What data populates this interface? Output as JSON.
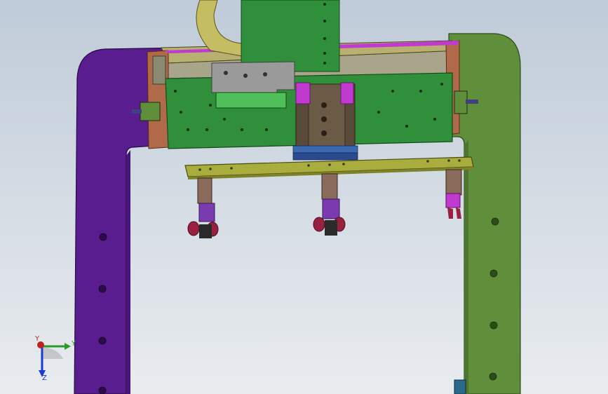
{
  "viewport": {
    "background": "gradient-light-blue-grey",
    "colors": {
      "bg_top": "#bfcbd8",
      "bg_bottom": "#e9ecef",
      "frame_left": "#5a1d8f",
      "frame_right": "#5f8f3a",
      "carriage_green": "#2f8f3a",
      "beam_olive": "#a8ad3e",
      "plate_grey": "#9a9a9a",
      "cylinder_brown": "#5a4a3a",
      "gripper_purple": "#7a3ab0",
      "gripper_red": "#9a2040",
      "accent_magenta": "#c03ad0"
    }
  },
  "triad": {
    "x_label": "Y",
    "y_label": "Y",
    "z_label": "Z",
    "x_color": "#2a9a2a",
    "y_color": "#c02020",
    "z_color": "#1a3ad0"
  }
}
